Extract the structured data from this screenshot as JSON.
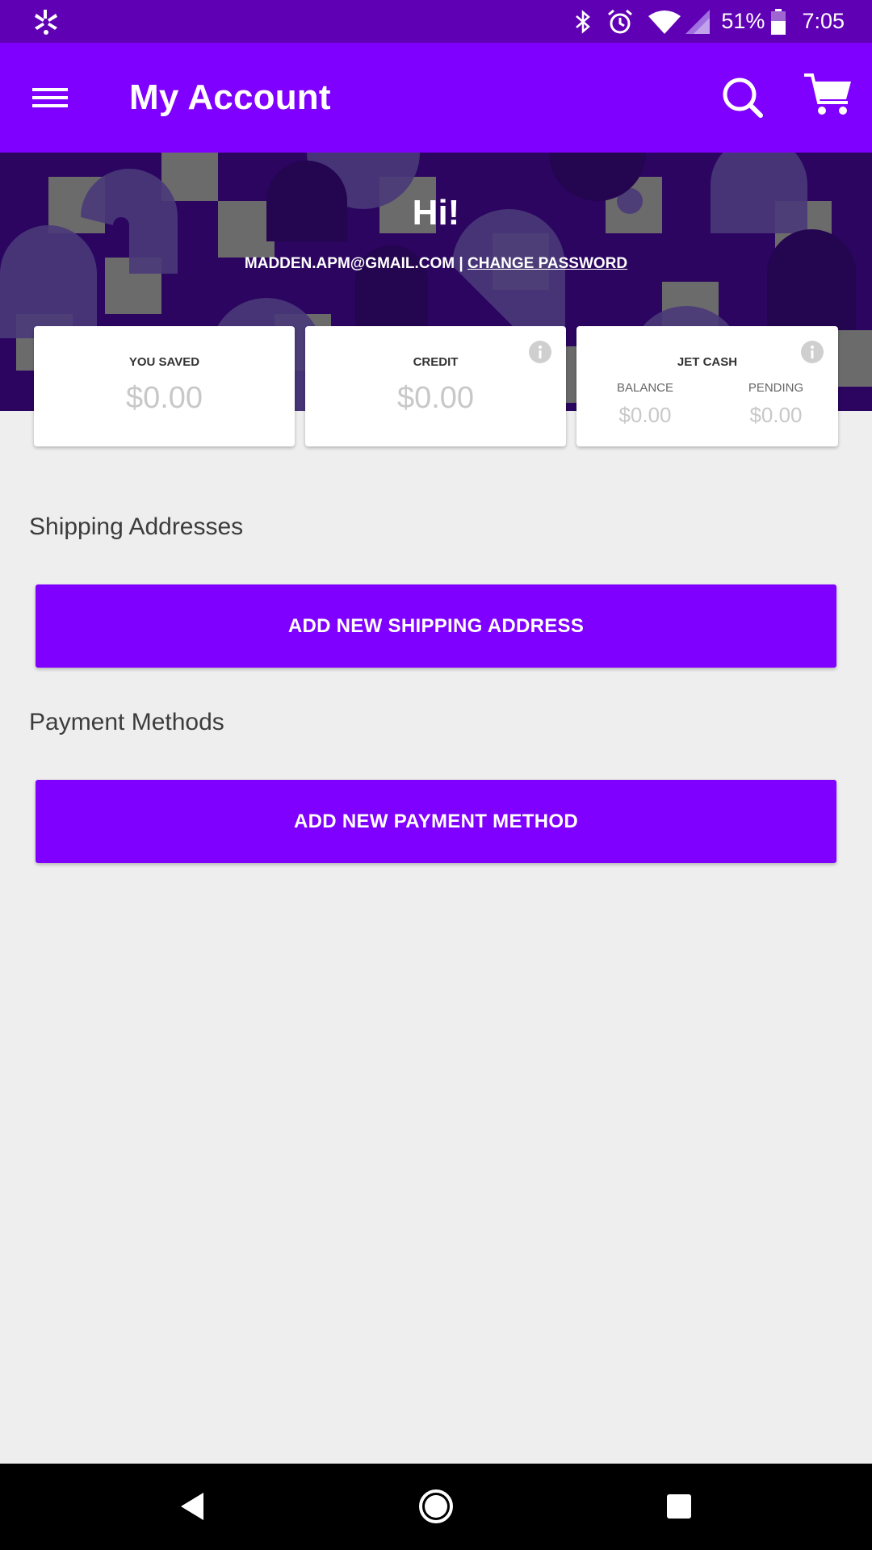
{
  "status_bar": {
    "battery_percent": "51%",
    "time": "7:05",
    "icons": [
      "yelp-icon",
      "bluetooth-icon",
      "alarm-icon",
      "wifi-icon",
      "signal-icon",
      "battery-icon"
    ]
  },
  "app_bar": {
    "title": "My Account",
    "icons": [
      "menu-icon",
      "search-icon",
      "cart-icon"
    ]
  },
  "hero": {
    "greeting": "Hi!",
    "email": "MADDEN.APM@GMAIL.COM",
    "separator": " | ",
    "change_password": "CHANGE PASSWORD"
  },
  "cards": {
    "you_saved": {
      "title": "YOU SAVED",
      "value": "$0.00"
    },
    "credit": {
      "title": "CREDIT",
      "value": "$0.00"
    },
    "jet_cash": {
      "title": "JET CASH",
      "balance_label": "BALANCE",
      "balance_value": "$0.00",
      "pending_label": "PENDING",
      "pending_value": "$0.00"
    }
  },
  "shipping": {
    "title": "Shipping Addresses",
    "button": "ADD NEW SHIPPING ADDRESS"
  },
  "payment": {
    "title": "Payment Methods",
    "button": "ADD NEW PAYMENT METHOD"
  },
  "colors": {
    "status_bar": "#5f00b5",
    "app_bar": "#8000ff",
    "hero_bg": "#2b0560",
    "page_bg": "#eeeeee",
    "value_gray": "#c8c8c8"
  }
}
